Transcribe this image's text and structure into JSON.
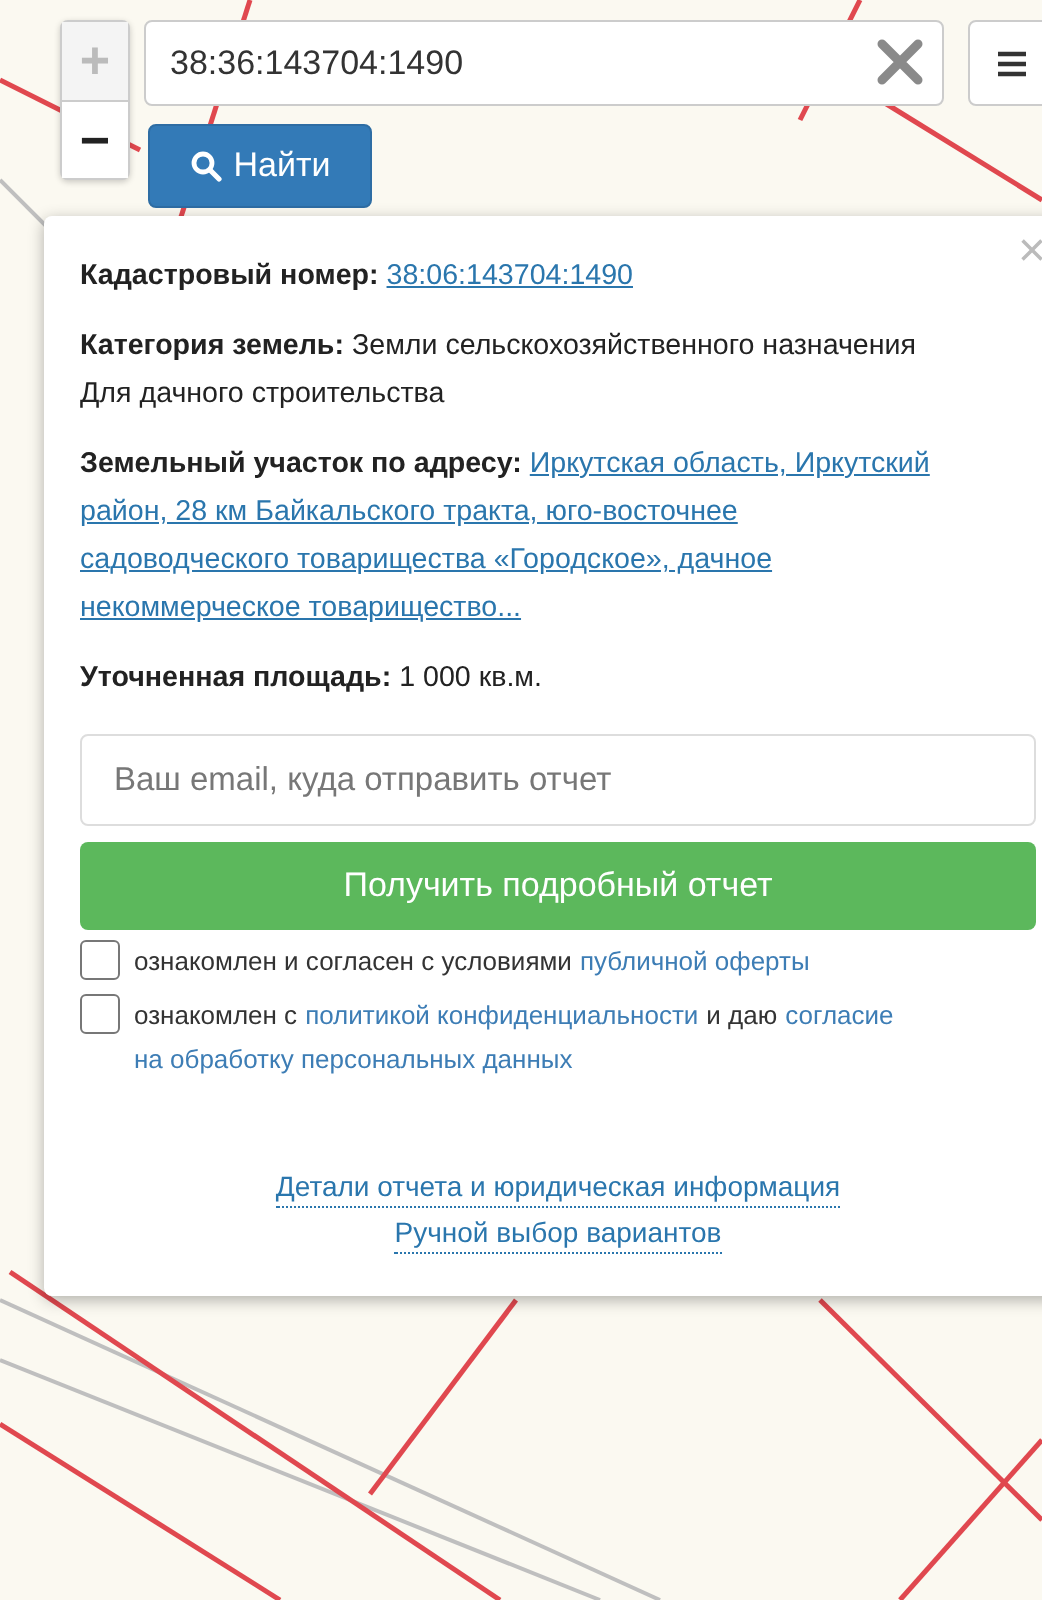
{
  "zoom_in": {
    "label": "+",
    "disabled": true
  },
  "zoom_out": {
    "label": "−",
    "disabled": false
  },
  "search": {
    "value": "38:36:143704:1490"
  },
  "find_button": {
    "label": "Найти"
  },
  "popup": {
    "close": "×",
    "rows": [
      {
        "label": "Кадастровый номер:",
        "segments": [
          {
            "kind": "link",
            "text": "38:06:143704:1490"
          }
        ]
      },
      {
        "label": "Категория земель:",
        "segments": [
          {
            "kind": "text",
            "text": "Земли сельскохозяйственного назначения"
          }
        ],
        "note": "Для дачного строительства"
      },
      {
        "label": "Земельный участок по адресу:",
        "segments": [
          {
            "kind": "link",
            "text": "Иркутская область, Иркутский"
          },
          {
            "kind": "link",
            "text": "район, 28 км Байкальского тракта, юго-восточнее"
          },
          {
            "kind": "link",
            "text": "садоводческого товарищества «Городское», дачное"
          },
          {
            "kind": "link",
            "text": "некоммерческое товарищество..."
          }
        ]
      },
      {
        "label": "Уточненная площадь:",
        "segments": [
          {
            "kind": "text",
            "text": "1 000 кв.м."
          }
        ]
      }
    ],
    "email": {
      "placeholder": "Ваш email, куда отправить отчет"
    },
    "submit": "Получить подробный отчет",
    "agreements": [
      {
        "checked": false,
        "segments": [
          {
            "kind": "text",
            "text": "ознакомлен и согласен с условиями"
          },
          {
            "kind": "link",
            "text": "публичной оферты"
          }
        ]
      },
      {
        "checked": false,
        "segments": [
          {
            "kind": "text",
            "text": "ознакомлен с"
          },
          {
            "kind": "link",
            "text": "политикой конфиденциальности"
          },
          {
            "kind": "text",
            "text": "и даю"
          },
          {
            "kind": "link",
            "text": "согласие"
          },
          {
            "kind": "link",
            "text": "на обработку персональных данных"
          }
        ]
      }
    ],
    "footer_links": [
      "Детали отчета и юридическая информация",
      "Ручной выбор вариантов"
    ]
  }
}
